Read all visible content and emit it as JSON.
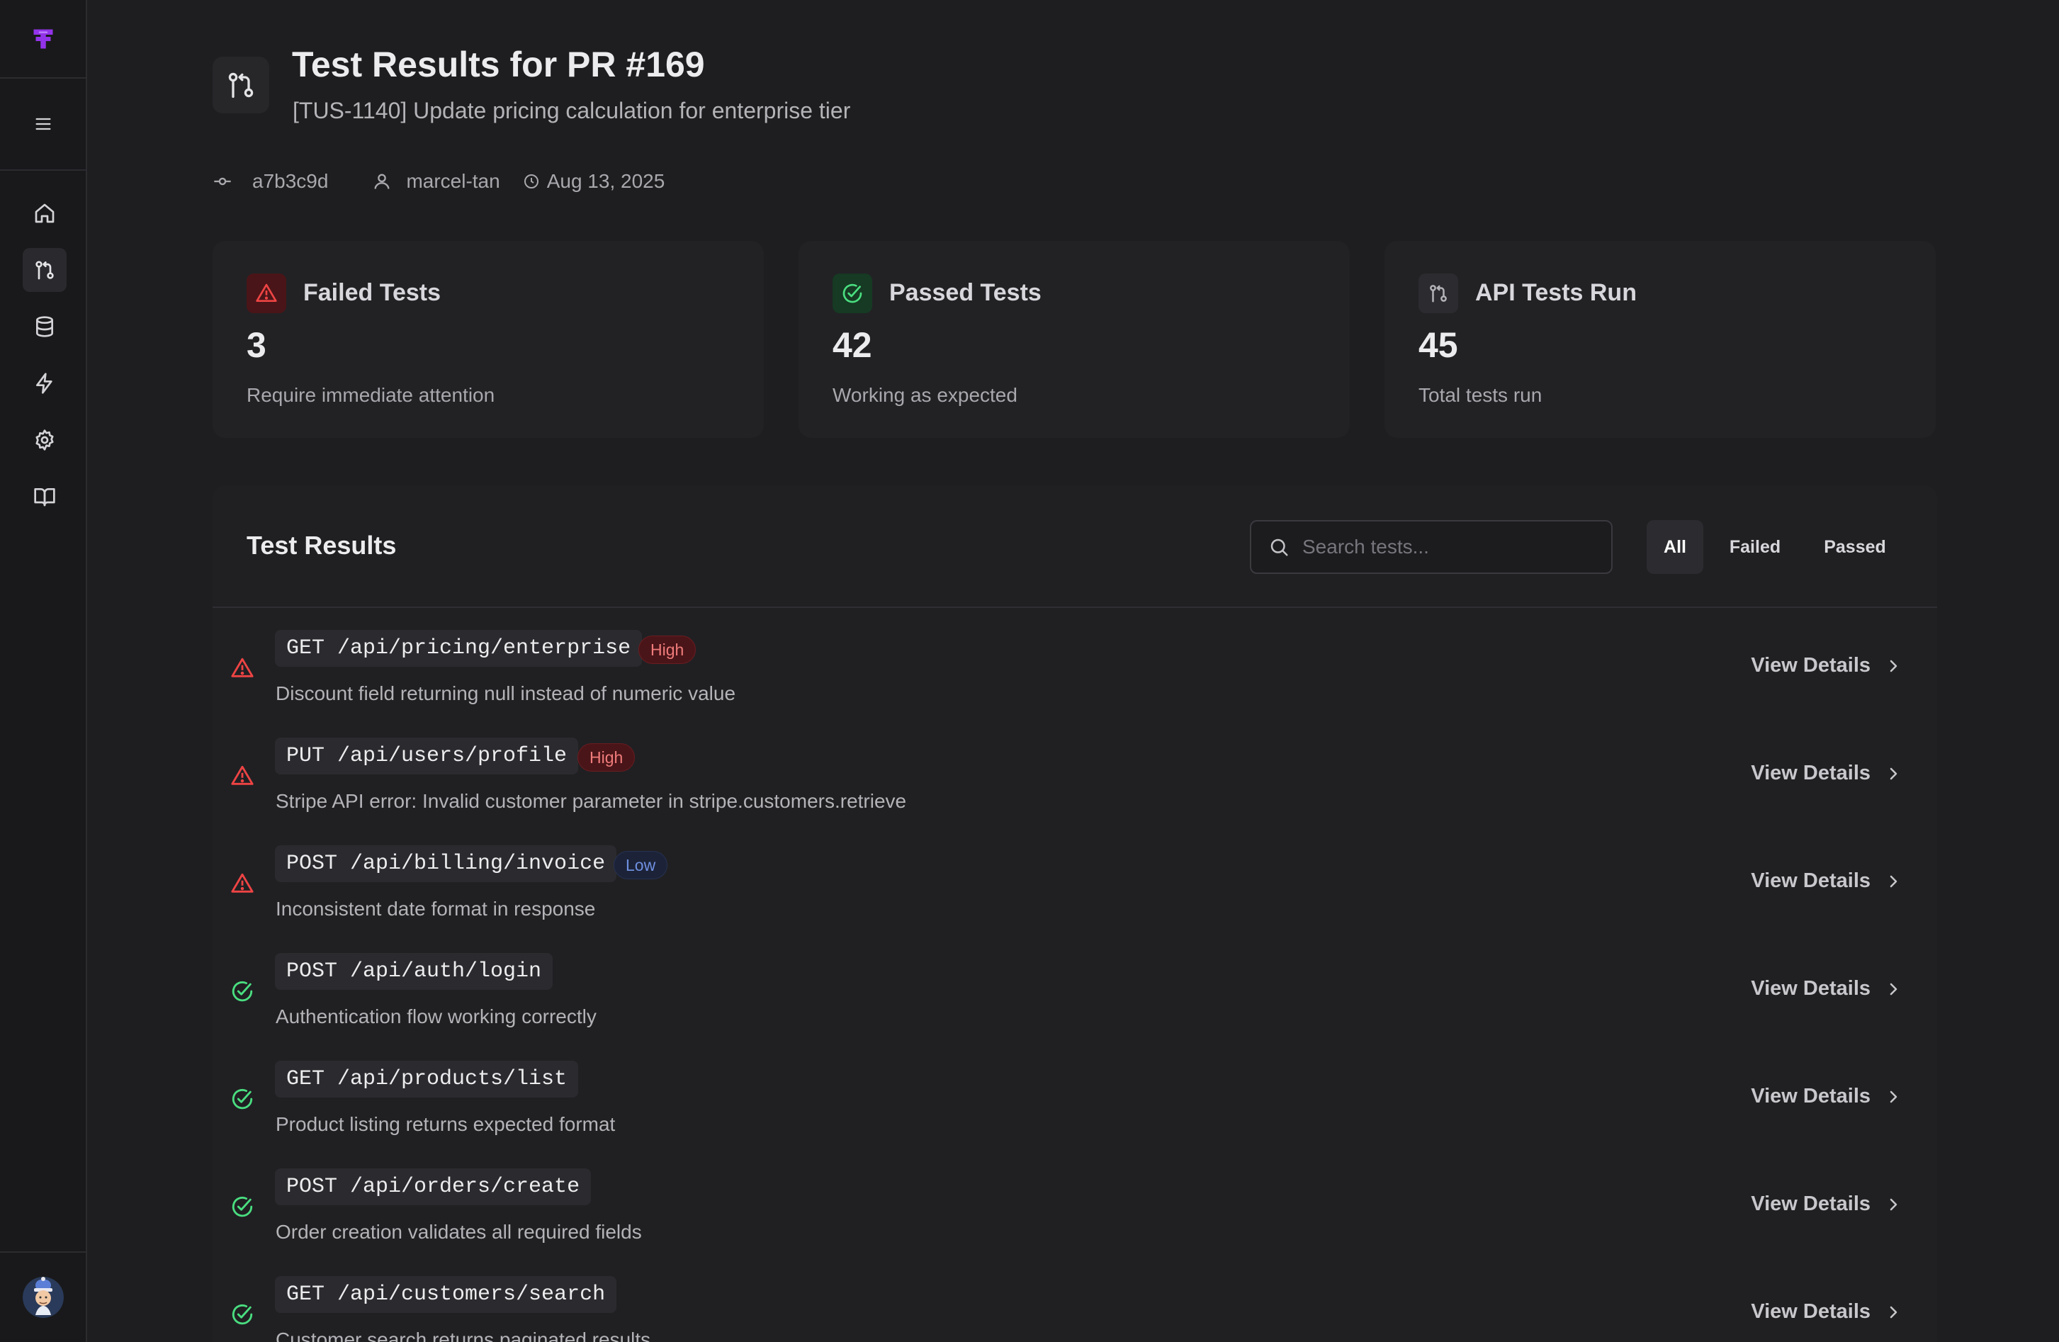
{
  "sidebar": {
    "logo_icon": "logo-icon",
    "menu_icon": "menu-icon",
    "items": [
      {
        "icon": "home-icon",
        "active": false
      },
      {
        "icon": "pull-request-icon",
        "active": true
      },
      {
        "icon": "database-icon",
        "active": false
      },
      {
        "icon": "lightning-icon",
        "active": false
      },
      {
        "icon": "gear-icon",
        "active": false
      },
      {
        "icon": "book-icon",
        "active": false
      }
    ],
    "avatar": "user-avatar"
  },
  "header": {
    "title": "Test Results for PR #169",
    "subtitle": "[TUS-1140] Update pricing calculation for enterprise tier",
    "commit": "a7b3c9d",
    "author": "marcel-tan",
    "date": "Aug 13, 2025"
  },
  "cards": [
    {
      "label": "Failed Tests",
      "value": "3",
      "sub": "Require immediate attention",
      "icon": "alert-triangle-icon",
      "accent": "#ef4444"
    },
    {
      "label": "Passed Tests",
      "value": "42",
      "sub": "Working as expected",
      "icon": "check-circle-icon",
      "accent": "#4ade80"
    },
    {
      "label": "API Tests Run",
      "value": "45",
      "sub": "Total tests run",
      "icon": "pull-request-icon",
      "accent": "#b4b4b8"
    }
  ],
  "results": {
    "title": "Test Results",
    "search_placeholder": "Search tests...",
    "tabs": [
      "All",
      "Failed",
      "Passed"
    ],
    "active_tab": "All",
    "view_label": "View Details",
    "rows": [
      {
        "status": "failed",
        "endpoint": "GET /api/pricing/enterprise",
        "badge": "High",
        "description": "Discount field returning null instead of numeric value"
      },
      {
        "status": "failed",
        "endpoint": "PUT /api/users/profile",
        "badge": "High",
        "description": "Stripe API error: Invalid customer parameter in stripe.customers.retrieve"
      },
      {
        "status": "failed",
        "endpoint": "POST /api/billing/invoice",
        "badge": "Low",
        "description": "Inconsistent date format in response"
      },
      {
        "status": "passed",
        "endpoint": "POST /api/auth/login",
        "badge": "",
        "description": "Authentication flow working correctly"
      },
      {
        "status": "passed",
        "endpoint": "GET /api/products/list",
        "badge": "",
        "description": "Product listing returns expected format"
      },
      {
        "status": "passed",
        "endpoint": "POST /api/orders/create",
        "badge": "",
        "description": "Order creation validates all required fields"
      },
      {
        "status": "passed",
        "endpoint": "GET /api/customers/search",
        "badge": "",
        "description": "Customer search returns paginated results"
      }
    ]
  },
  "colors": {
    "failed": "#ef4444",
    "passed": "#4ade80",
    "brand": "#a855f7"
  }
}
